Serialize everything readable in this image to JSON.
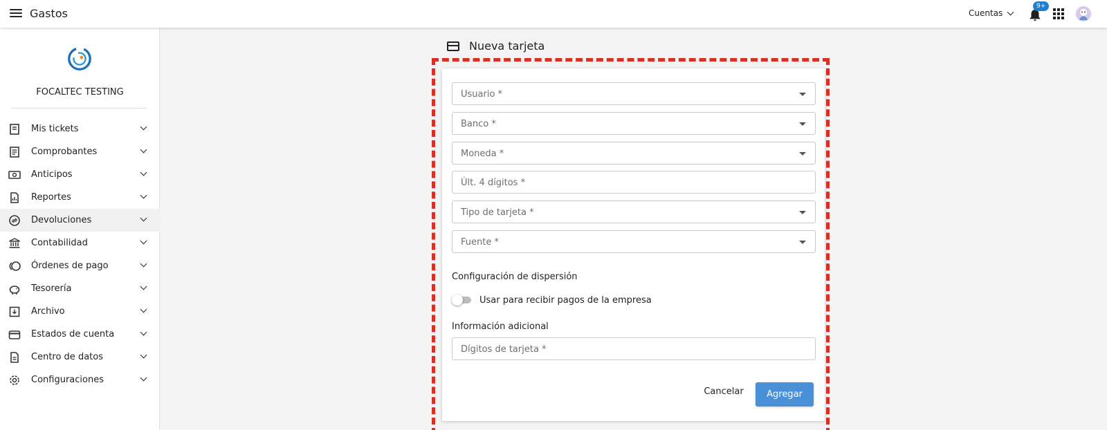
{
  "header": {
    "title": "Gastos",
    "accounts_label": "Cuentas",
    "notification_badge": "9+"
  },
  "sidebar": {
    "company": "FOCALTEC TESTING",
    "items": [
      {
        "label": "Mis tickets",
        "icon": "receipt-icon"
      },
      {
        "label": "Comprobantes",
        "icon": "document-icon"
      },
      {
        "label": "Anticipos",
        "icon": "cash-icon"
      },
      {
        "label": "Reportes",
        "icon": "report-icon"
      },
      {
        "label": "Devoluciones",
        "icon": "refund-icon"
      },
      {
        "label": "Contabilidad",
        "icon": "bank-icon"
      },
      {
        "label": "Órdenes de pago",
        "icon": "coins-icon"
      },
      {
        "label": "Tesorería",
        "icon": "piggy-bank-icon"
      },
      {
        "label": "Archivo",
        "icon": "archive-icon"
      },
      {
        "label": "Estados de cuenta",
        "icon": "wallet-icon"
      },
      {
        "label": "Centro de datos",
        "icon": "data-icon"
      },
      {
        "label": "Configuraciones",
        "icon": "gear-icon"
      }
    ]
  },
  "page": {
    "title": "Nueva tarjeta"
  },
  "form": {
    "usuario": "Usuario *",
    "banco": "Banco *",
    "moneda": "Moneda *",
    "ultimos_digitos": "Últ. 4 dígitos *",
    "tipo_tarjeta": "Tipo de tarjeta *",
    "fuente": "Fuente *",
    "dispersion_title": "Configuración de dispersión",
    "dispersion_toggle": "Usar para recibir pagos de la empresa",
    "info_title": "Información adicional",
    "digitos_tarjeta": "Dígitos de tarjeta *",
    "cancel": "Cancelar",
    "submit": "Agregar"
  },
  "colors": {
    "accent": "#4a90d9",
    "highlight": "#d93025",
    "badge": "#1f7fd0"
  }
}
